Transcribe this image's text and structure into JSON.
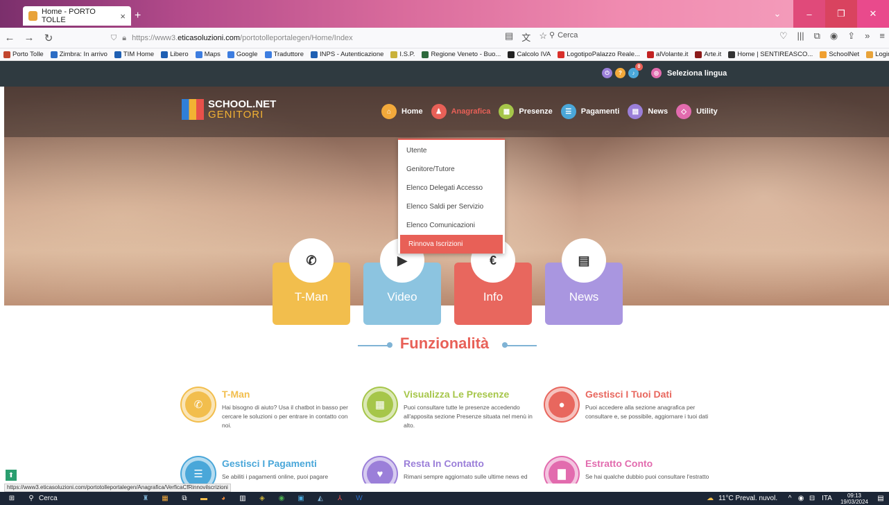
{
  "browser": {
    "tab_title": "Home - PORTO TOLLE",
    "new_tab_symbol": "+",
    "url_prefix": "https://www3.",
    "url_domain": "eticasoluzioni.com",
    "url_path": "/portotolleportalegen/Home/Index",
    "search_placeholder": "Cerca",
    "status_url": "https://www3.eticasoluzioni.com/portotolleportalegen/Anagrafica/VerficaCfRinnovilscrizioni"
  },
  "bookmarks": [
    {
      "label": "Porto Tolle",
      "color": "#c2452d"
    },
    {
      "label": "Zimbra: In arrivo",
      "color": "#2b6cc4"
    },
    {
      "label": "TIM Home",
      "color": "#1e5fb3"
    },
    {
      "label": "Libero",
      "color": "#1e5fb3"
    },
    {
      "label": "Maps",
      "color": "#3d7de0"
    },
    {
      "label": "Google",
      "color": "#3d7de0"
    },
    {
      "label": "Traduttore",
      "color": "#3d7de0"
    },
    {
      "label": "INPS - Autenticazione",
      "color": "#1e5fb3"
    },
    {
      "label": "I.S.P.",
      "color": "#c9b13a"
    },
    {
      "label": "Regione Veneto - Buo...",
      "color": "#2d6a3c"
    },
    {
      "label": "Calcolo IVA",
      "color": "#222222"
    },
    {
      "label": "LogotipoPalazzo Reale...",
      "color": "#d9302b"
    },
    {
      "label": "alVolante.it",
      "color": "#c22222"
    },
    {
      "label": "Arte.it",
      "color": "#8b1a1a"
    },
    {
      "label": "Home | SENTIREASCO...",
      "color": "#333333"
    },
    {
      "label": "SchoolNet",
      "color": "#f0a030"
    },
    {
      "label": "Login - Portale Genitori",
      "color": "#e8a33a"
    }
  ],
  "site": {
    "logo_line1": "SCHOOL.NET",
    "logo_line2": "GENITORI",
    "language_label": "Seleziona lingua",
    "notif_count": "0",
    "menu": [
      {
        "label": "Home",
        "color": "#f2a93b",
        "active": false
      },
      {
        "label": "Anagrafica",
        "color": "#e86057",
        "active": true
      },
      {
        "label": "Presenze",
        "color": "#a6c64a",
        "active": false
      },
      {
        "label": "Pagamenti",
        "color": "#4aa7d9",
        "active": false
      },
      {
        "label": "News",
        "color": "#9b7fd9",
        "active": false
      },
      {
        "label": "Utility",
        "color": "#e26bae",
        "active": false
      }
    ],
    "dropdown": [
      {
        "label": "Utente"
      },
      {
        "label": "Genitore/Tutore"
      },
      {
        "label": "Elenco Delegati Accesso"
      },
      {
        "label": "Elenco Saldi per Servizio"
      },
      {
        "label": "Elenco Comunicazioni"
      },
      {
        "label": "Rinnova Iscrizioni"
      }
    ],
    "cards": [
      {
        "label": "T-Man",
        "color": "#f2be4d",
        "icon": "phone-icon",
        "glyph": "✆"
      },
      {
        "label": "Video",
        "color": "#8cc4e0",
        "icon": "play-icon",
        "glyph": "▶"
      },
      {
        "label": "Info",
        "color": "#e8675e",
        "icon": "euro-icon",
        "glyph": "€"
      },
      {
        "label": "News",
        "color": "#a996e0",
        "icon": "newspaper-icon",
        "glyph": "▤"
      }
    ],
    "section_title": "Funzionalità",
    "features": [
      {
        "title": "T-Man",
        "color": "#f2be4d",
        "icon": "phone-icon",
        "glyph": "✆",
        "text": "Hai bisogno di aiuto? Usa il chatbot in basso per cercare le soluzioni o per entrare in contatto con noi."
      },
      {
        "title": "Visualizza Le Presenze",
        "color": "#a6c64a",
        "icon": "calendar-icon",
        "glyph": "▦",
        "text": "Puoi consultare tutte le presenze accedendo all'apposita sezione Presenze situata nel menù in alto."
      },
      {
        "title": "Gestisci I Tuoi Dati",
        "color": "#e8675e",
        "icon": "user-icon",
        "glyph": "●",
        "text": "Puoi accedere alla sezione anagrafica per consultare e, se possibile, aggiornare i tuoi dati"
      },
      {
        "title": "Gestisci I Pagamenti",
        "color": "#4aa7d9",
        "icon": "list-icon",
        "glyph": "☰",
        "text": "Se abiliti i pagamenti online, puoi pagare ...ocemente con pochi click i servizi erogati"
      },
      {
        "title": "Resta In Contatto",
        "color": "#9b7fd9",
        "icon": "heart-icon",
        "glyph": "♥",
        "text": "Rimani sempre aggiornato sulle ultime news ed informazioni riguardanti i servizi"
      },
      {
        "title": "Estratto Conto",
        "color": "#e26bae",
        "icon": "document-icon",
        "glyph": "▇",
        "text": "Se hai qualche dubbio puoi consultare l'estratto conto accedendo dalla sezione"
      }
    ]
  },
  "taskbar": {
    "search_label": "Cerca",
    "weather": "11°C  Preval. nuvol.",
    "lang": "ITA",
    "time": "09:13",
    "date": "19/03/2024"
  }
}
